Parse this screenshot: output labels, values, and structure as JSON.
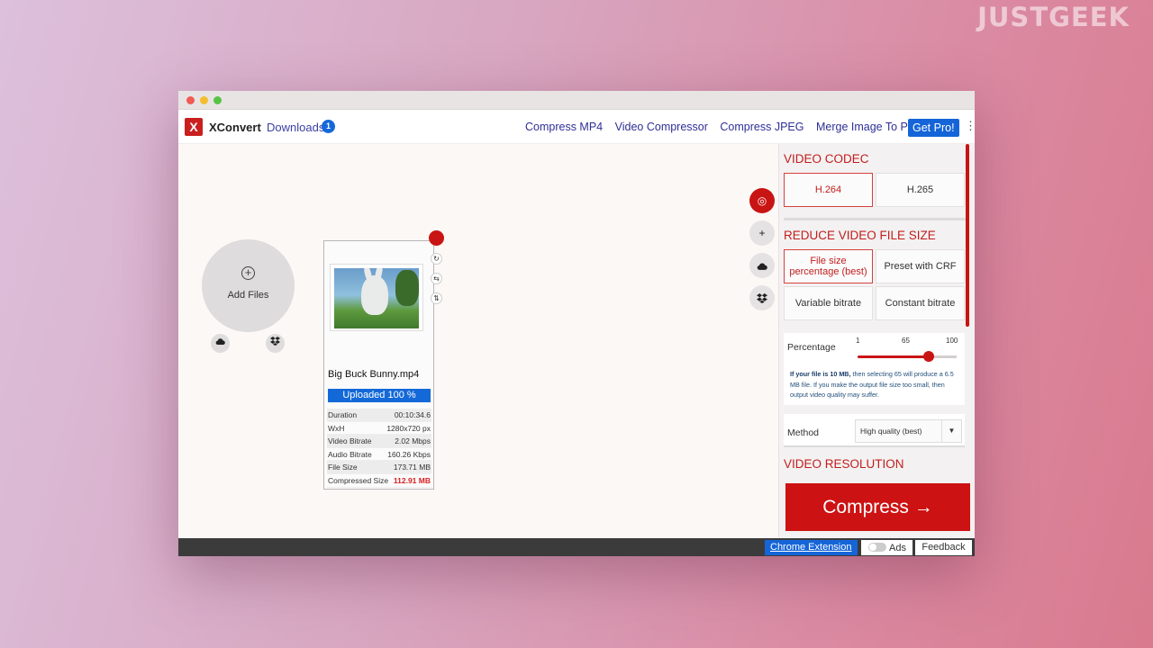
{
  "watermark": "JUSTGEEK",
  "nav": {
    "logo_letter": "X",
    "brand": "XConvert",
    "downloads_label": "Downloads",
    "downloads_count": "1",
    "links": [
      "Compress MP4",
      "Video Compressor",
      "Compress JPEG",
      "Merge Image To PDF"
    ],
    "get_pro": "Get Pro!",
    "menu_icon": "⋮"
  },
  "upload": {
    "add_files_label": "Add Files",
    "add_icon": "+"
  },
  "file": {
    "name": "Big Buck Bunny.mp4",
    "status": "Uploaded 100 %",
    "upload_progress": 100,
    "details": [
      {
        "label": "Duration",
        "value": "00:10:34.6"
      },
      {
        "label": "WxH",
        "value": "1280x720 px"
      },
      {
        "label": "Video Bitrate",
        "value": "2.02 Mbps"
      },
      {
        "label": "Audio Bitrate",
        "value": "160.26 Kbps"
      },
      {
        "label": "File Size",
        "value": "173.71 MB"
      }
    ],
    "compressed_label": "Compressed Size",
    "compressed_value": "112.91 MB"
  },
  "settings": {
    "codec_title": "VIDEO CODEC",
    "codec_options": [
      "H.264",
      "H.265"
    ],
    "codec_selected": "H.264",
    "reduce_title": "REDUCE VIDEO FILE SIZE",
    "reduce_options": [
      "File size percentage (best)",
      "Preset with CRF",
      "Variable bitrate",
      "Constant bitrate"
    ],
    "reduce_selected": "File size percentage (best)",
    "percentage_label": "Percentage",
    "percentage_min": "1",
    "percentage_mid": "65",
    "percentage_max": "100",
    "percentage_value": 65,
    "note_bold": "If your file is 10 MB,",
    "note_rest": " then selecting 65 will produce a 6.5 MB file. If you make the output file size too small, then output video quality may suffer.",
    "method_label": "Method",
    "method_value": "High quality (best)",
    "resolution_title": "VIDEO RESOLUTION",
    "compress_label": "Compress →"
  },
  "footer": {
    "chrome_extension": "Chrome Extension",
    "ads": "Ads",
    "feedback": "Feedback"
  },
  "colors": {
    "accent_red": "#c91414",
    "link_blue": "#1565d8"
  },
  "icons": [
    "close-window-icon",
    "minimize-window-icon",
    "zoom-window-icon",
    "plus-circle-icon",
    "cloud-upload-icon",
    "dropbox-icon",
    "rotate-icon",
    "flip-horizontal-icon",
    "flip-vertical-icon",
    "settings-target-icon",
    "add-icon",
    "kebab-menu-icon",
    "dropdown-arrow-icon"
  ]
}
